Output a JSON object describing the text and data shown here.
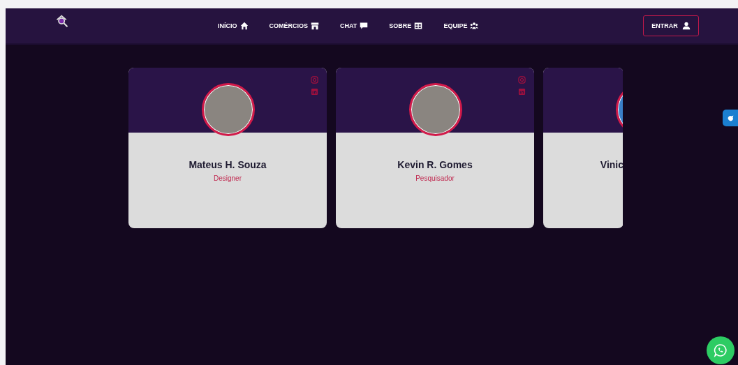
{
  "nav": {
    "items": [
      {
        "label": "INÍCIO",
        "kind": "home"
      },
      {
        "label": "COMÉRCIOS",
        "kind": "store"
      },
      {
        "label": "CHAT",
        "kind": "chat"
      },
      {
        "label": "SOBRE",
        "kind": "table"
      },
      {
        "label": "EQUIPE",
        "kind": "users"
      }
    ],
    "login": "ENTRAR"
  },
  "team": [
    {
      "name": "Mateus H. Souza",
      "role": "Designer",
      "partial": false
    },
    {
      "name": "Kevin R. Gomes",
      "role": "Pesquisador",
      "partial": false
    },
    {
      "name": "Vinic",
      "partial": true
    }
  ]
}
